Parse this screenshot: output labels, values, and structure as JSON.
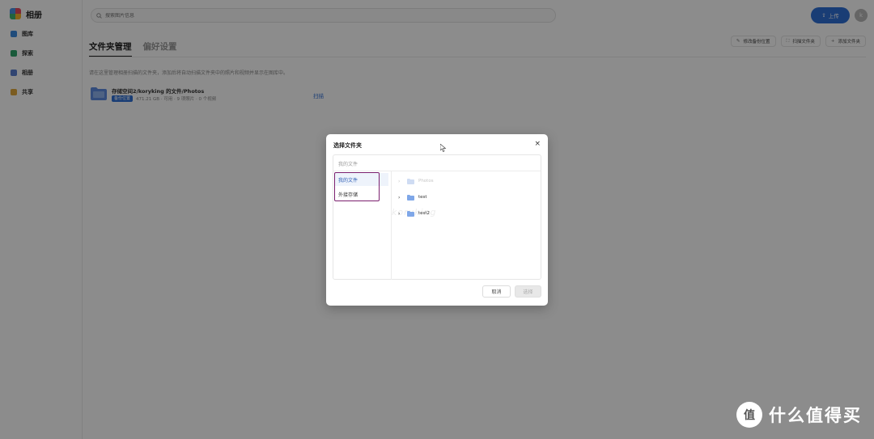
{
  "app": {
    "brand": "相册",
    "nav": [
      {
        "label": "图库",
        "icon": "gallery-icon"
      },
      {
        "label": "探索",
        "icon": "explore-icon"
      },
      {
        "label": "相册",
        "icon": "album-icon"
      },
      {
        "label": "共享",
        "icon": "share-icon"
      }
    ],
    "search": {
      "placeholder": "搜索图片信息"
    },
    "upload_label": "上传",
    "avatar_initial": "k",
    "tabs": [
      {
        "label": "文件夹管理",
        "active": true
      },
      {
        "label": "偏好设置",
        "active": false
      }
    ],
    "actions": [
      {
        "label": "修改备份位置",
        "icon": "edit-icon"
      },
      {
        "label": "扫描文件夹",
        "icon": "scan-icon"
      },
      {
        "label": "添加文件夹",
        "icon": "plus-icon"
      }
    ],
    "hint": "请在这里管理相册扫描的文件夹，添加后将自动扫描文件夹中的照片和视频并显示在图库中。",
    "folder": {
      "path": "存储空间2/koryking 的文件/Photos",
      "tag": "备份位置",
      "meta": "471.21 GB · 可用 · 9 项照片 · 0 个视频"
    },
    "scan_label": "扫描"
  },
  "dialog": {
    "title": "选择文件夹",
    "close_glyph": "×",
    "path": "我的文件",
    "locations": [
      "我的文件",
      "外接存储"
    ],
    "folders": [
      {
        "name": "Photos",
        "disabled": true
      },
      {
        "name": "test",
        "disabled": false
      },
      {
        "name": "test2",
        "disabled": false
      }
    ],
    "watermark": "koryking",
    "cancel_label": "取消",
    "confirm_label": "选择"
  },
  "site_watermark": {
    "text": "什么值得买",
    "glyph": "值"
  },
  "colors": {
    "accent": "#2f6fd6",
    "overlay": "rgba(0,0,0,0.45)",
    "highlight_box": "#7a1f6e",
    "folder": "#7fa7e8"
  }
}
